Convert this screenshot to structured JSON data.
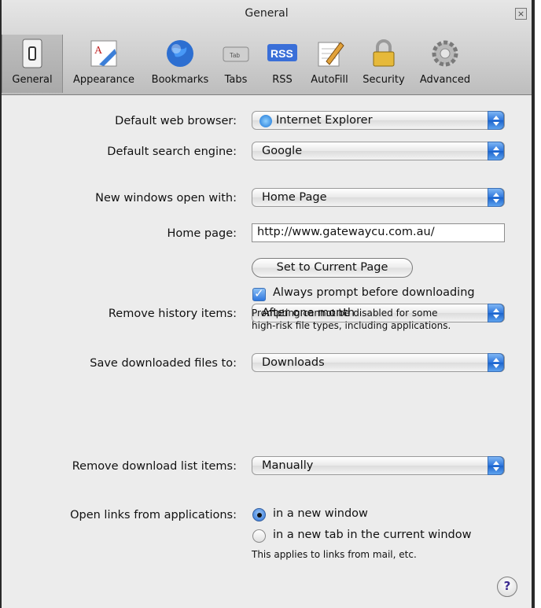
{
  "window": {
    "title": "General"
  },
  "toolbar": {
    "items": [
      {
        "label": "General",
        "icon": "general-switch-icon"
      },
      {
        "label": "Appearance",
        "icon": "appearance-icon"
      },
      {
        "label": "Bookmarks",
        "icon": "globe-icon"
      },
      {
        "label": "Tabs",
        "icon": "tabs-icon",
        "badge": "Tab"
      },
      {
        "label": "RSS",
        "icon": "rss-icon",
        "badge": "RSS"
      },
      {
        "label": "AutoFill",
        "icon": "autofill-pencil-icon"
      },
      {
        "label": "Security",
        "icon": "lock-icon"
      },
      {
        "label": "Advanced",
        "icon": "gear-icon"
      }
    ]
  },
  "prefs": {
    "default_browser": {
      "label": "Default web browser:",
      "value": "Internet Explorer"
    },
    "default_search": {
      "label": "Default search engine:",
      "value": "Google"
    },
    "new_windows": {
      "label": "New windows open with:",
      "value": "Home Page"
    },
    "home_page": {
      "label": "Home page:",
      "value": "http://www.gatewaycu.com.au/"
    },
    "set_current_button": "Set to Current Page",
    "remove_history": {
      "label": "Remove history items:",
      "value": "After one month"
    },
    "save_downloads": {
      "label": "Save downloaded files to:",
      "value": "Downloads"
    },
    "always_prompt": {
      "label": "Always prompt before downloading",
      "checked": true
    },
    "prompt_note_1": "Prompting cannot be disabled for some",
    "prompt_note_2": "high-risk file types, including applications.",
    "remove_download_items": {
      "label": "Remove download list items:",
      "value": "Manually"
    },
    "open_links": {
      "label": "Open links from applications:",
      "option_new_window": "in a new window",
      "option_new_tab": "in a new tab in the current window",
      "selected": "in a new window",
      "note": "This applies to links from mail, etc."
    },
    "help_symbol": "?"
  }
}
